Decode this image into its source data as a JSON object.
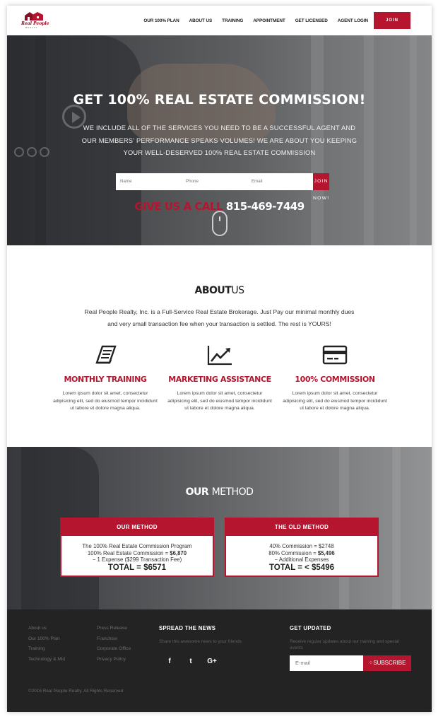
{
  "header": {
    "brand": "Real People",
    "brand_sub": "REALTY",
    "nav": [
      "OUR 100% PLAN",
      "ABOUT US",
      "TRAINING",
      "APPOINTMENT",
      "GET LICENSED",
      "AGENT LOGIN"
    ],
    "join_label": "JOIN NOW!"
  },
  "hero": {
    "title": "GET 100% REAL ESTATE COMMISSION!",
    "lead": "WE INCLUDE ALL OF THE SERVICES YOU NEED TO BE A SUCCESSFUL AGENT AND OUR MEMBERS' PERFORMANCE SPEAKS VOLUMES! WE ARE ABOUT YOU KEEPING YOUR WELL-DESERVED 100% REAL ESTATE COMMISSION",
    "form": {
      "name_placeholder": "Name",
      "phone_placeholder": "Phone",
      "email_placeholder": "Email",
      "button": "JOIN NOW!"
    },
    "call_label": "GIVE US A CALL",
    "call_number": "815-469-7449"
  },
  "about": {
    "title_bold": "ABOUT",
    "title_light": "US",
    "intro": "Real People Realty, Inc. is a Full-Service Real Estate Brokerage. Just Pay our minimal monthly dues and very small transaction fee when your transaction is settled. The rest is YOURS!",
    "features": [
      {
        "icon": "book-icon",
        "title": "MONTHLY TRAINING",
        "text": "Lorem ipsum dolor sit amet, consectetur adipisicing elit, sed do eiusmod tempor incididunt ut labore et dolore magna aliqua."
      },
      {
        "icon": "chart-icon",
        "title": "MARKETING ASSISTANCE",
        "text": "Lorem ipsum dolor sit amet, consectetur adipisicing elit, sed do eiusmod tempor incididunt ut labore et dolore magna aliqua."
      },
      {
        "icon": "credit-card-icon",
        "title": "100% COMMISSION",
        "text": "Lorem ipsum dolor sit amet, consectetur adipisicing elit, sed do eiusmod tempor incididunt ut labore et dolore magna aliqua."
      }
    ]
  },
  "method": {
    "title_bold": "OUR",
    "title_light": "METHOD",
    "ours": {
      "heading": "OUR METHOD",
      "line1": "The 100% Real Estate Commission Program",
      "line2_text": "100% Real Estate Commission = ",
      "line2_value": "$6,870",
      "line3": "− 1 Expense ($299 Transaction Fee)",
      "total": "TOTAL = $6571"
    },
    "old": {
      "heading": "THE OLD METHOD",
      "line1": "40% Commission = $2748",
      "line2_text": "80% Commission = ",
      "line2_value": "$5,496",
      "line3": "− Additional Expenses",
      "total": "TOTAL = < $5496"
    }
  },
  "footer": {
    "col1": [
      "About us",
      "Our 100% Plan",
      "Training",
      "Technology & Mld"
    ],
    "col2": [
      "Press Release",
      "Franchise",
      "Corporate Office",
      "Privacy Policy"
    ],
    "spread_title": "SPREAD THE NEWS",
    "spread_text": "Share this awesome news to your friends",
    "social": [
      "f",
      "t",
      "G+"
    ],
    "updated_title": "GET UPDATED",
    "updated_text": "Receive regular updates about our training and special events",
    "email_placeholder": "E-mail",
    "subscribe_label": "SUBSCRIBE",
    "copyright": "©2016 Real People Realty. All Rights Reserved"
  },
  "colors": {
    "accent": "#b5152f",
    "footer_bg": "#232323"
  }
}
